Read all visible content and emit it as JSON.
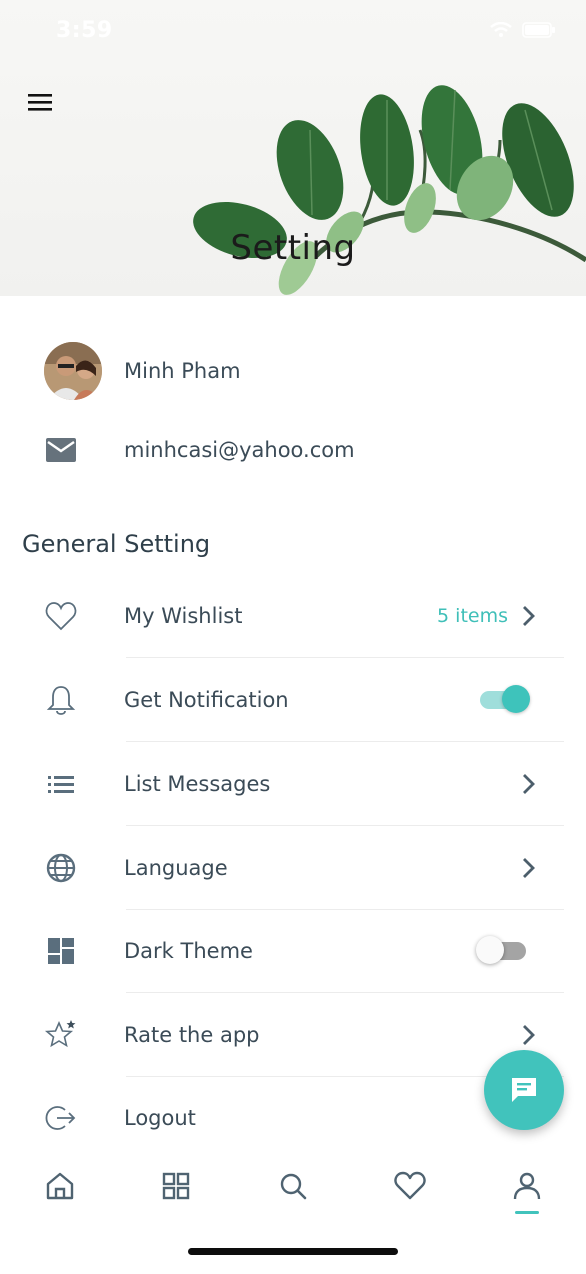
{
  "status_bar": {
    "time": "3:59"
  },
  "header": {
    "title": "Setting",
    "menu_icon": "hamburger-menu-icon"
  },
  "profile": {
    "name": "Minh Pham",
    "email": "minhcasi@yahoo.com"
  },
  "general_setting": {
    "title": "General Setting",
    "items": [
      {
        "label": "My Wishlist",
        "icon": "heart-outline-icon",
        "value": "5 items",
        "control": "chevron"
      },
      {
        "label": "Get Notification",
        "icon": "bell-icon",
        "control": "toggle",
        "on": true
      },
      {
        "label": "List Messages",
        "icon": "list-icon",
        "control": "chevron"
      },
      {
        "label": "Language",
        "icon": "globe-icon",
        "control": "chevron"
      },
      {
        "label": "Dark Theme",
        "icon": "dashboard-icon",
        "control": "toggle",
        "on": false
      },
      {
        "label": "Rate the app",
        "icon": "star-icon",
        "control": "chevron"
      },
      {
        "label": "Logout",
        "icon": "logout-icon",
        "control": "none"
      }
    ]
  },
  "bottom_nav": {
    "items": [
      "home-icon",
      "grid-icon",
      "search-icon",
      "heart-icon",
      "profile-icon"
    ],
    "active": "profile-icon"
  },
  "colors": {
    "accent": "#41c3bc",
    "text": "#3b4b57",
    "icon": "#5a6e7d"
  }
}
